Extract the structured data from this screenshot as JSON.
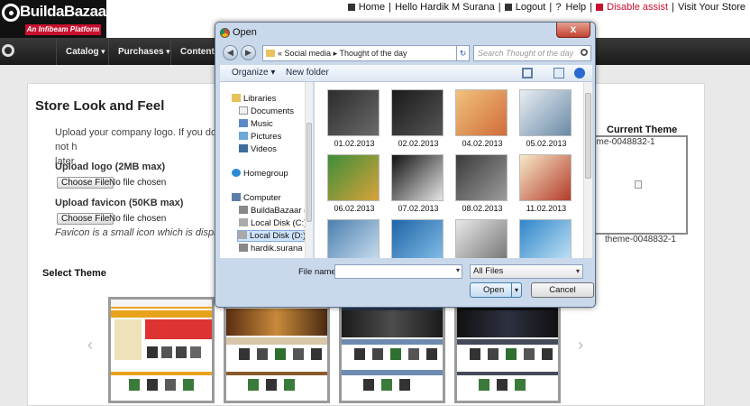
{
  "brand": {
    "name": "BuildaBazaar",
    "tagline": "An Infibeam Platform"
  },
  "top_links": [
    {
      "label": "Home",
      "highlight": false,
      "icon": "home-icon"
    },
    {
      "label": "Hello Hardik M Surana",
      "highlight": false,
      "icon": ""
    },
    {
      "label": "Logout",
      "highlight": false,
      "icon": "lock-icon"
    },
    {
      "label": "Help",
      "highlight": false,
      "icon": "help-icon"
    },
    {
      "label": "Disable assist",
      "highlight": true,
      "icon": "assist-icon"
    },
    {
      "label": "Visit Your Store",
      "highlight": false,
      "icon": ""
    }
  ],
  "nav": [
    "Catalog",
    "Purchases",
    "Content"
  ],
  "panel": {
    "title": "Store Look and Feel",
    "description": "Upload your company logo. If you do not h",
    "description_line2": "later.",
    "logo_label": "Upload logo (2MB max)",
    "favicon_label": "Upload favicon (50KB max)",
    "choose_file": "Choose File",
    "no_file": "No file chosen",
    "favicon_note": "Favicon is a small icon which is displayed o",
    "current_theme_title": "Current Theme",
    "current_theme_name_top": "eme-0048832-1",
    "current_theme_name_bottom": "theme-0048832-1",
    "select_theme_title": "Select Theme",
    "prev_arrow": "‹",
    "next_arrow": "›"
  },
  "dialog": {
    "title": "Open",
    "close": "x",
    "back": "◀",
    "forward": "▶",
    "address_sep": "«",
    "address_parts": [
      "Social media",
      "Thought of the day"
    ],
    "address_arrow": "▸",
    "refresh": "↻",
    "search_placeholder": "Search Thought of the day",
    "organize": "Organize ▾",
    "new_folder": "New folder",
    "tree": [
      {
        "label": "Libraries",
        "icon": "library-icon",
        "selected": false
      },
      {
        "label": "Documents",
        "icon": "documents-icon",
        "selected": false
      },
      {
        "label": "Music",
        "icon": "music-icon",
        "selected": false
      },
      {
        "label": "Pictures",
        "icon": "pictures-icon",
        "selected": false
      },
      {
        "label": "Videos",
        "icon": "videos-icon",
        "selected": false
      },
      {
        "label": "Homegroup",
        "icon": "homegroup-icon",
        "selected": false
      },
      {
        "label": "Computer",
        "icon": "computer-icon",
        "selected": false
      },
      {
        "label": "BuildaBazaar (\\\\1",
        "icon": "network-drive-icon",
        "selected": false
      },
      {
        "label": "Local Disk (C:)",
        "icon": "disk-icon",
        "selected": false
      },
      {
        "label": "Local Disk (D:)",
        "icon": "disk-icon",
        "selected": true
      },
      {
        "label": "hardik.surana (\\\\",
        "icon": "network-drive-icon",
        "selected": false
      }
    ],
    "files": [
      {
        "name": "01.02.2013",
        "theme": [
          "#2c2c2c",
          "#6a6a6a"
        ]
      },
      {
        "name": "02.02.2013",
        "theme": [
          "#1a1a1a",
          "#555555"
        ]
      },
      {
        "name": "04.02.2013",
        "theme": [
          "#f1c27d",
          "#d06c3a"
        ]
      },
      {
        "name": "05.02.2013",
        "theme": [
          "#e9eef3",
          "#6a8aa6"
        ]
      },
      {
        "name": "06.02.2013",
        "theme": [
          "#3e8e3a",
          "#d9a23a"
        ]
      },
      {
        "name": "07.02.2013",
        "theme": [
          "#111111",
          "#e5e5e5"
        ]
      },
      {
        "name": "08.02.2013",
        "theme": [
          "#3a3a3a",
          "#9c9c9c"
        ]
      },
      {
        "name": "11.02.2013",
        "theme": [
          "#f7e9c8",
          "#b33b2a"
        ]
      },
      {
        "name": "",
        "theme": [
          "#4b7fae",
          "#cfe2f2"
        ]
      },
      {
        "name": "",
        "theme": [
          "#1e64a8",
          "#88c2ea"
        ]
      },
      {
        "name": "",
        "theme": [
          "#e8e8e8",
          "#707070"
        ]
      },
      {
        "name": "",
        "theme": [
          "#2f86c9",
          "#c8e6f7"
        ]
      }
    ],
    "file_name_label": "File name:",
    "file_name_value": "",
    "file_type": "All Files",
    "open_label": "Open",
    "open_split": "▾",
    "cancel_label": "Cancel"
  },
  "colors": {
    "accent_red": "#c8102e",
    "dialog_frame": "#c9d9eb"
  }
}
